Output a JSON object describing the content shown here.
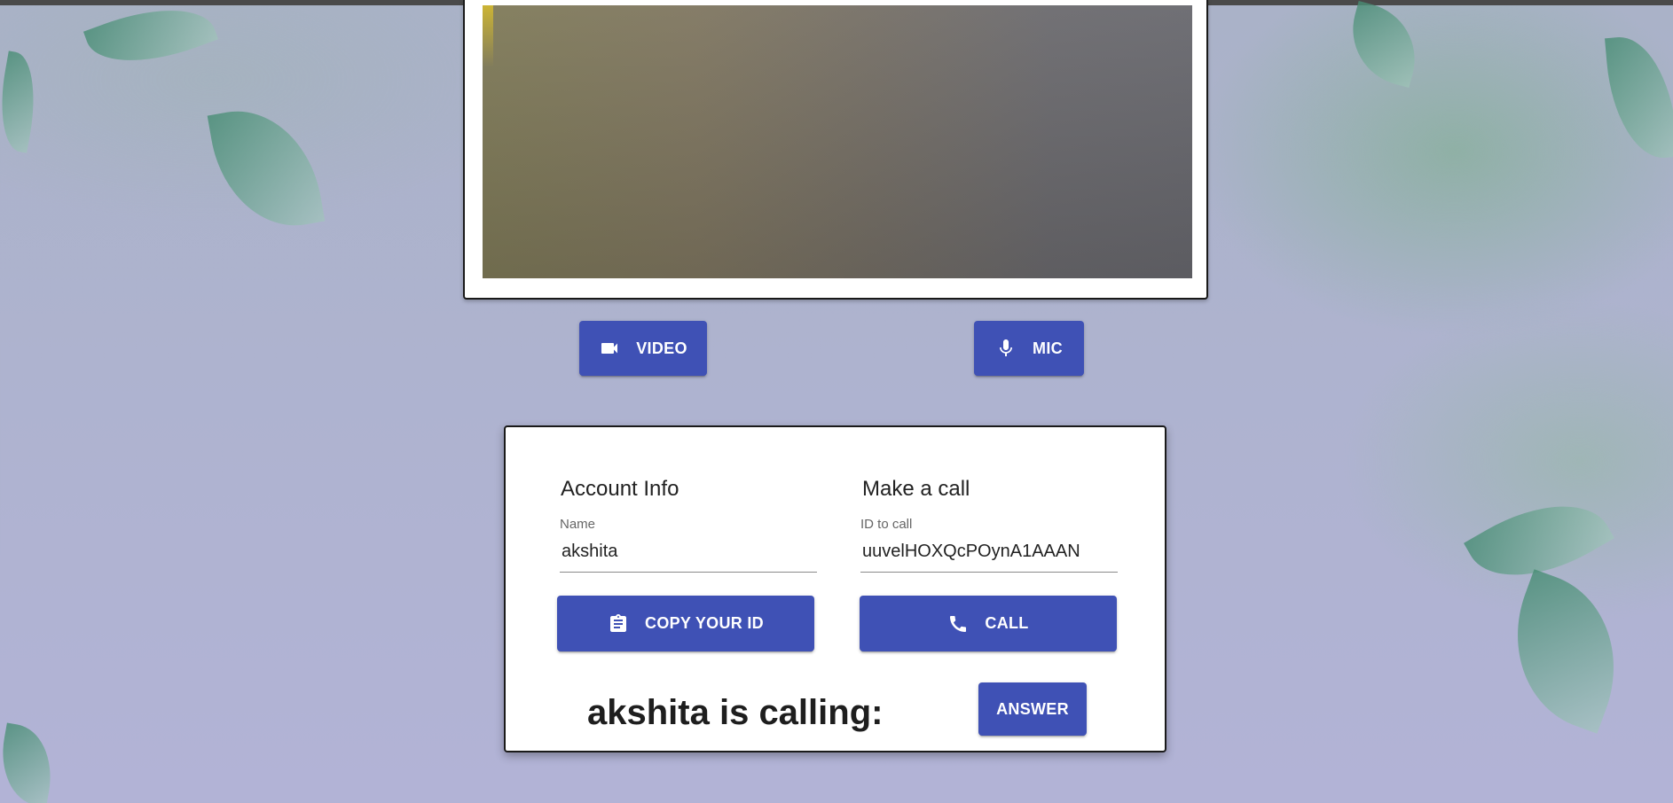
{
  "media_controls": {
    "video_label": "VIDEO",
    "mic_label": "MIC"
  },
  "account": {
    "title": "Account Info",
    "name_label": "Name",
    "name_value": "akshita",
    "copy_label": "COPY YOUR ID"
  },
  "call": {
    "title": "Make a call",
    "id_label": "ID to call",
    "id_value": "uuvelHOXQcPOynA1AAAN",
    "call_label": "CALL"
  },
  "incoming": {
    "text": "akshita is calling:",
    "answer_label": "ANSWER"
  },
  "icons": {
    "video": "videocam-icon",
    "mic": "mic-icon",
    "copy": "clipboard-icon",
    "call": "phone-icon"
  },
  "colors": {
    "button": "#3f51b5",
    "card_background": "#ffffff"
  }
}
